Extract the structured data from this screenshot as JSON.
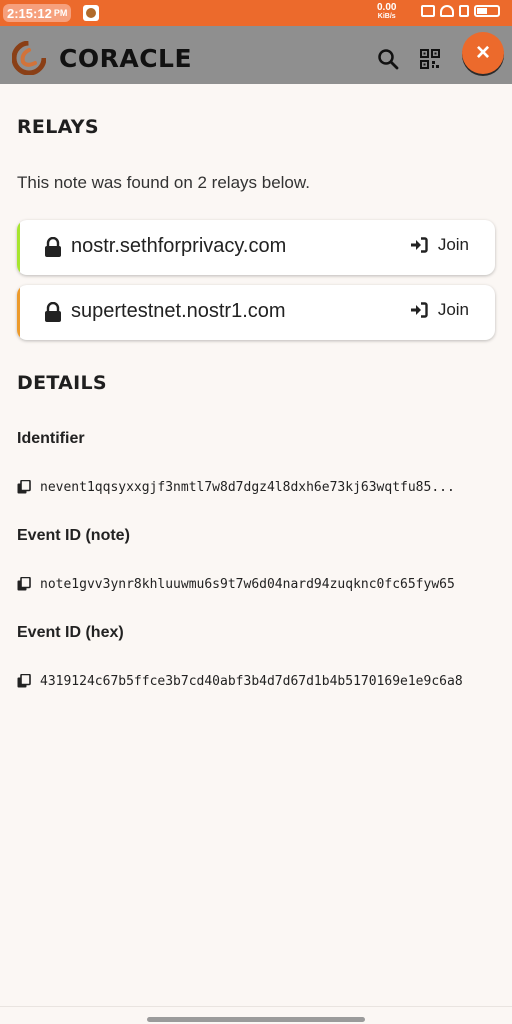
{
  "status_bar": {
    "time": "2:15:12",
    "ampm": "PM",
    "net_speed": "0.00",
    "net_unit": "KiB/s"
  },
  "app": {
    "name": "CORACLE",
    "accent": "#ec6a2c"
  },
  "header": {
    "search_icon": "search-icon",
    "qr_icon": "qr-code-icon",
    "close_label": "×"
  },
  "relays": {
    "title": "RELAYS",
    "description": "This note was found on 2 relays below.",
    "items": [
      {
        "url": "nostr.sethforprivacy.com",
        "join_label": "Join",
        "accent": "#a7e52f"
      },
      {
        "url": "supertestnet.nostr1.com",
        "join_label": "Join",
        "accent": "#ec9a2c"
      }
    ]
  },
  "details": {
    "title": "DETAILS",
    "fields": [
      {
        "label": "Identifier",
        "value": "nevent1qqsyxxgjf3nmtl7w8d7dgz4l8dxh6e73kj63wqtfu85..."
      },
      {
        "label": "Event ID (note)",
        "value": "note1gvv3ynr8khluuwmu6s9t7w6d04nard94zuqknc0fc65fyw65"
      },
      {
        "label": "Event ID (hex)",
        "value": "4319124c67b5ffce3b7cd40abf3b4d7d67d1b4b5170169e1e9c6a8"
      }
    ]
  }
}
